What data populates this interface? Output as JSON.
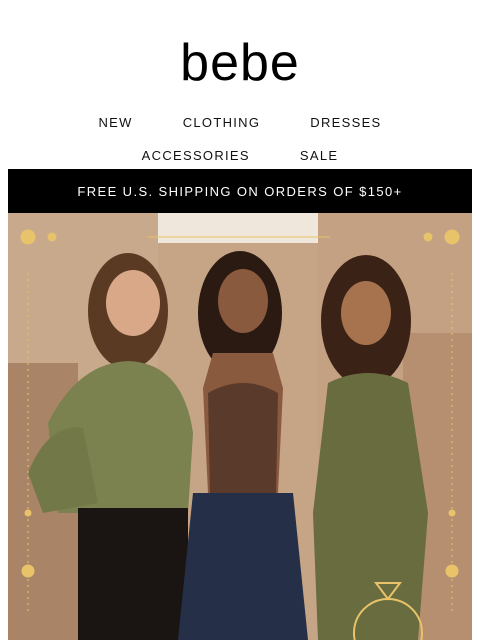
{
  "brand": {
    "logo_text": "bebe"
  },
  "nav": {
    "row1": [
      "NEW",
      "CLOTHING",
      "DRESSES"
    ],
    "row2": [
      "ACCESSORIES",
      "SALE"
    ]
  },
  "promo": {
    "text": "FREE U.S. SHIPPING ON ORDERS OF $150+"
  },
  "hero": {
    "alt": "Three women posing in olive, brown and green outfits with celestial gold border",
    "colors": {
      "gold": "#e8c36a",
      "sky": "#efe6dc",
      "wall": "#c7a587"
    }
  }
}
